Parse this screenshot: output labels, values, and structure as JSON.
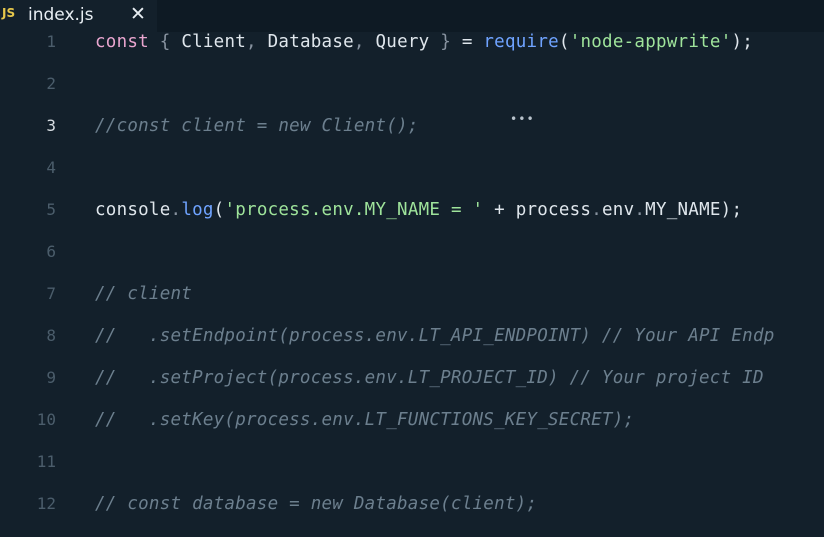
{
  "tab": {
    "icon_label": "JS",
    "title": "index.js",
    "close_glyph": "✕"
  },
  "editor": {
    "active_line": 3,
    "hint_glyph": "•••",
    "lines": [
      {
        "num": "1",
        "tokens": [
          {
            "t": "const",
            "c": "kw"
          },
          {
            "t": " ",
            "c": "plain"
          },
          {
            "t": "{",
            "c": "punc"
          },
          {
            "t": " Client",
            "c": "plain"
          },
          {
            "t": ",",
            "c": "punc"
          },
          {
            "t": " Database",
            "c": "plain"
          },
          {
            "t": ",",
            "c": "punc"
          },
          {
            "t": " Query ",
            "c": "plain"
          },
          {
            "t": "}",
            "c": "punc"
          },
          {
            "t": " = ",
            "c": "plain"
          },
          {
            "t": "require",
            "c": "fn"
          },
          {
            "t": "(",
            "c": "plain"
          },
          {
            "t": "'node-appwrite'",
            "c": "str"
          },
          {
            "t": ");",
            "c": "plain"
          }
        ]
      },
      {
        "num": "2",
        "tokens": []
      },
      {
        "num": "3",
        "tokens": [
          {
            "t": "//const client = new Client();",
            "c": "cm"
          }
        ]
      },
      {
        "num": "4",
        "tokens": []
      },
      {
        "num": "5",
        "tokens": [
          {
            "t": "console",
            "c": "plain"
          },
          {
            "t": ".",
            "c": "punc"
          },
          {
            "t": "log",
            "c": "fn"
          },
          {
            "t": "(",
            "c": "plain"
          },
          {
            "t": "'process.env.MY_NAME = '",
            "c": "str"
          },
          {
            "t": " + process",
            "c": "plain"
          },
          {
            "t": ".",
            "c": "punc"
          },
          {
            "t": "env",
            "c": "plain"
          },
          {
            "t": ".",
            "c": "punc"
          },
          {
            "t": "MY_NAME);",
            "c": "plain"
          }
        ]
      },
      {
        "num": "6",
        "tokens": []
      },
      {
        "num": "7",
        "tokens": [
          {
            "t": "// client",
            "c": "cm"
          }
        ]
      },
      {
        "num": "8",
        "tokens": [
          {
            "t": "//   .setEndpoint(process.env.LT_API_ENDPOINT) // Your API Endp",
            "c": "cm"
          }
        ]
      },
      {
        "num": "9",
        "tokens": [
          {
            "t": "//   .setProject(process.env.LT_PROJECT_ID) // Your project ID",
            "c": "cm"
          }
        ]
      },
      {
        "num": "10",
        "tokens": [
          {
            "t": "//   .setKey(process.env.LT_FUNCTIONS_KEY_SECRET);",
            "c": "cm"
          }
        ]
      },
      {
        "num": "11",
        "tokens": []
      },
      {
        "num": "12",
        "tokens": [
          {
            "t": "// const database = new Database(client);",
            "c": "cm"
          }
        ]
      }
    ]
  }
}
